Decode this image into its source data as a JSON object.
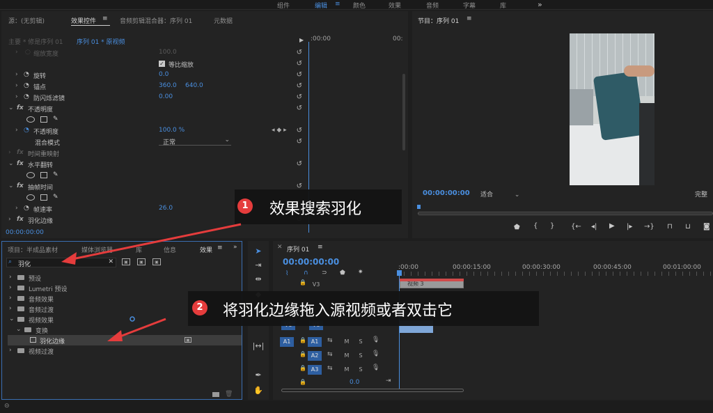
{
  "topbar": {
    "tabs": [
      "组件",
      "编辑",
      "颜色",
      "效果",
      "音频",
      "字幕",
      "库"
    ],
    "active": "编辑",
    "overflow": "»"
  },
  "source_panel": {
    "tab_source": "源：(无剪辑)",
    "tab_effect_controls": "效果控件",
    "tab_audio_mixer": "音频剪辑混合器：序列 01",
    "tab_metadata": "元数据",
    "menu_icon": "≡",
    "master_label": "主要 * 修是序列 01",
    "clip_label": "序列 01 * 原视频",
    "timecode_zero": ":00:00",
    "timecode_end": "00:",
    "bottom_timecode": "00:00:00:00"
  },
  "effect_rows": {
    "scale_width": {
      "label": "缩放宽度",
      "value": "100.0"
    },
    "uniform_scale": {
      "label": "等比缩放"
    },
    "rotation": {
      "label": "旋转",
      "value": "0.0"
    },
    "anchor": {
      "label": "锚点",
      "x": "360.0",
      "y": "640.0"
    },
    "flicker": {
      "label": "防闪烁滤镜",
      "value": "0.00"
    },
    "opacity_group": {
      "label": "不透明度"
    },
    "opacity": {
      "label": "不透明度",
      "value": "100.0 %"
    },
    "blend": {
      "label": "混合模式",
      "value": "正常"
    },
    "time_remap": {
      "label": "时间重映射"
    },
    "hflip": {
      "label": "水平翻转"
    },
    "posterize": {
      "label": "抽帧时间"
    },
    "framerate": {
      "label": "帧速率",
      "value": "26.0"
    },
    "feather": {
      "label": "羽化边缘"
    }
  },
  "program_panel": {
    "title": "节目：序列 01",
    "menu_icon": "≡",
    "timecode": "00:00:00:00",
    "fit": "适合",
    "quality": "完整"
  },
  "project_panel": {
    "tabs": [
      "项目：半成品素材",
      "媒体浏览器",
      "库",
      "信息",
      "效果"
    ],
    "active_tab": "效果",
    "menu_icon": "≡",
    "overflow": "»",
    "search_value": "羽化",
    "clear_icon": "✕",
    "tree": [
      {
        "label": "预设",
        "depth": 0
      },
      {
        "label": "Lumetri 预设",
        "depth": 0
      },
      {
        "label": "音频效果",
        "depth": 0
      },
      {
        "label": "音频过渡",
        "depth": 0
      },
      {
        "label": "视频效果",
        "depth": 0,
        "open": true
      },
      {
        "label": "变换",
        "depth": 1,
        "open": true
      },
      {
        "label": "羽化边缘",
        "depth": 2,
        "selected": true
      },
      {
        "label": "视频过渡",
        "depth": 0
      }
    ]
  },
  "timeline": {
    "tab": "序列 01",
    "menu_icon": "≡",
    "timecode": "00:00:00:00",
    "ruler": [
      ":00:00",
      "00:00:15:00",
      "00:00:30:00",
      "00:00:45:00",
      "00:01:00:00"
    ],
    "tracks": {
      "v3": "V3",
      "v1_src": "V1",
      "v1": "V1",
      "a1_src": "A1",
      "a1": "A1",
      "a2": "A2",
      "a3": "A3",
      "m": "M",
      "s": "S",
      "master_vol": "0.0"
    },
    "clip_label": "视频 3"
  },
  "callouts": {
    "one": {
      "num": "1",
      "text": "效果搜索羽化"
    },
    "two": {
      "num": "2",
      "text": "将羽化边缘拖入源视频或者双击它"
    }
  },
  "colors": {
    "accent": "#4a8fe0",
    "callout_badge": "#e53c3c",
    "arrow": "#e53c3c"
  }
}
